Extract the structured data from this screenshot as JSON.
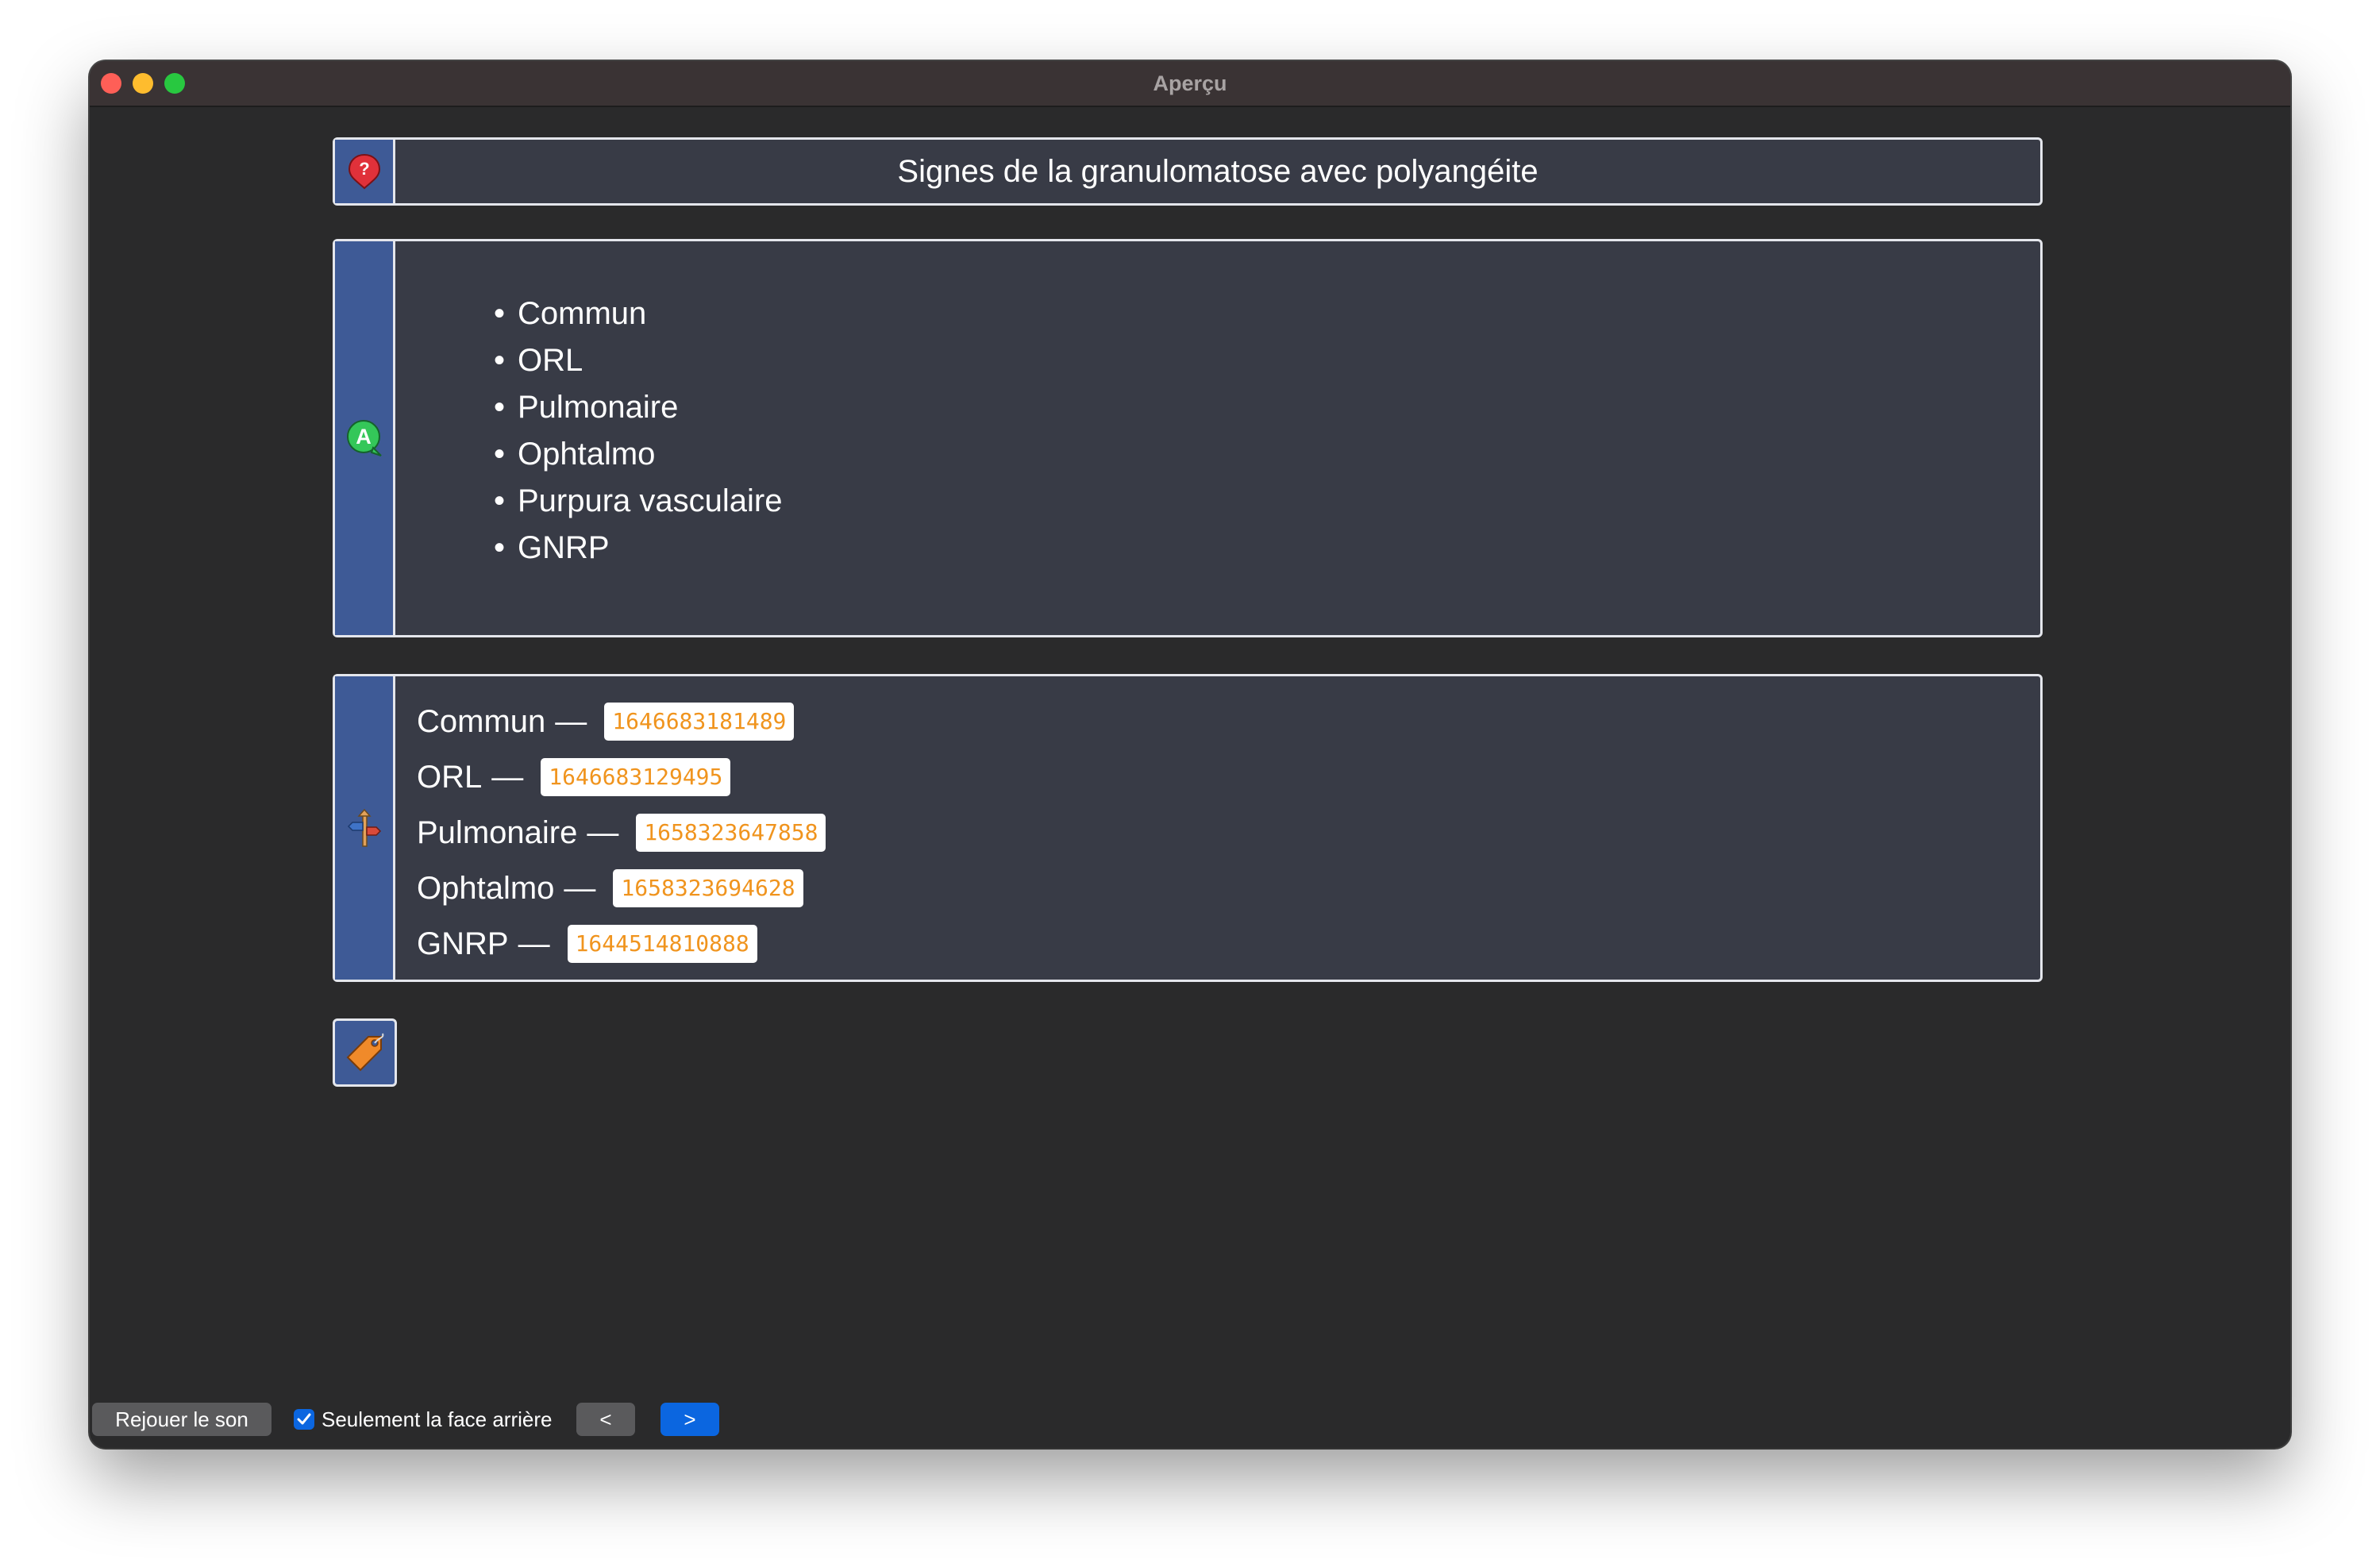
{
  "window": {
    "title": "Aperçu"
  },
  "question": {
    "text": "Signes de la granulomatose avec polyangéite",
    "icon": "question-marker-icon"
  },
  "answer": {
    "icon": "answer-a-icon",
    "items": [
      "Commun",
      "ORL",
      "Pulmonaire",
      "Ophtalmo",
      "Purpura vasculaire",
      "GNRP"
    ]
  },
  "references": {
    "icon": "signpost-icon",
    "items": [
      {
        "label": "Commun",
        "id": "1646683181489"
      },
      {
        "label": "ORL",
        "id": "1646683129495"
      },
      {
        "label": "Pulmonaire",
        "id": "1658323647858"
      },
      {
        "label": "Ophtalmo",
        "id": "1658323694628"
      },
      {
        "label": "GNRP",
        "id": "1644514810888"
      }
    ],
    "separator": "—"
  },
  "tags": {
    "icon": "tag-icon"
  },
  "toolbar": {
    "replay_label": "Rejouer le son",
    "back_only_label": "Seulement la face arrière",
    "back_only_checked": true,
    "prev_label": "<",
    "next_label": ">"
  },
  "colors": {
    "card_bg": "#383b46",
    "side_bar": "#3e5a96",
    "accent_blue": "#0b66e0",
    "ref_text": "#f0941e"
  }
}
